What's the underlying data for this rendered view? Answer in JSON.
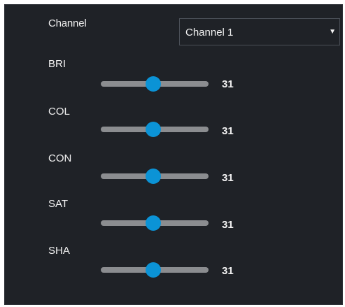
{
  "channel": {
    "label": "Channel",
    "selected": "Channel 1",
    "caret_icon": "triangle-down-icon"
  },
  "sliders": [
    {
      "label": "BRI",
      "value": "31",
      "fraction": 0.49
    },
    {
      "label": "COL",
      "value": "31",
      "fraction": 0.49
    },
    {
      "label": "CON",
      "value": "31",
      "fraction": 0.49
    },
    {
      "label": "SAT",
      "value": "31",
      "fraction": 0.49
    },
    {
      "label": "SHA",
      "value": "31",
      "fraction": 0.49
    }
  ],
  "colors": {
    "panel_background": "#1f2227",
    "track": "#8b8d90",
    "thumb": "#0b93d6",
    "text": "#f2f2f2"
  }
}
